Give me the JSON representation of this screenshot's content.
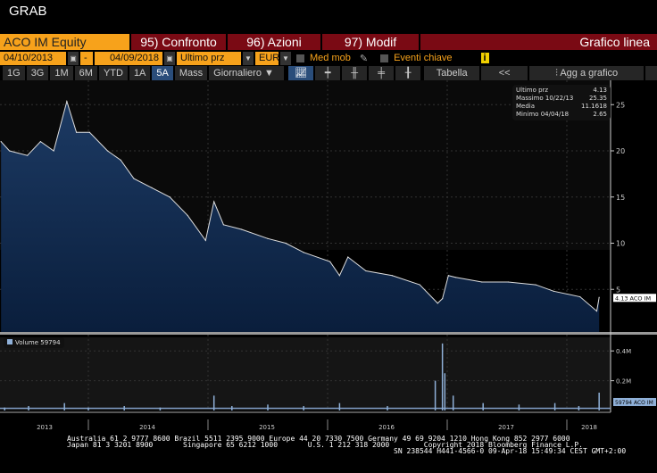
{
  "title": "GRAB",
  "toolbar": {
    "security": "ACO IM Equity",
    "compare": "95) Confronto",
    "actions": "96) Azioni",
    "modify": "97) Modif",
    "chart_type": "Grafico linea"
  },
  "controls": {
    "start_date": "04/10/2013",
    "dash": "-",
    "end_date": "04/09/2018",
    "field": "Ultimo prz",
    "currency": "EUR",
    "moving_avg": "Med mob",
    "key_events": "Eventi chiave",
    "info": "i"
  },
  "periods": [
    "1G",
    "3G",
    "1M",
    "6M",
    "YTD",
    "1A",
    "5A",
    "Mass"
  ],
  "selected_period": "5A",
  "frequency": "Giornaliero ▼",
  "table_label": "Tabella",
  "collapse_label": "<<",
  "add_label": "Agg a grafico",
  "legend": {
    "rows": [
      [
        "Ultimo prz",
        "4.13"
      ],
      [
        "Massimo 10/22/13",
        "25.35"
      ],
      [
        "Media",
        "11.1618"
      ],
      [
        "Minimo 04/04/18",
        "2.65"
      ]
    ]
  },
  "volume_legend": "Volume 59794",
  "price_tag": "4.13 ACO IM",
  "volume_tag": "59794 ACO IM",
  "footer": "Australia 61 2 9777 8600 Brazil 5511 2395 9000 Europe 44 20 7330 7500 Germany 49 69 9204 1210 Hong Kong 852 2977 6000\nJapan 81 3 3201 8900       Singapore 65 6212 1000       U.S. 1 212 318 2000        Copyright 2018 Bloomberg Finance L.P.\n                                                                            SN 238544 H441-4566-0 09-Apr-18 15:49:34 CEST GMT+2:00",
  "chart_data": {
    "type": "area",
    "x_ticks": [
      "2013",
      "2014",
      "2015",
      "2016",
      "2017",
      "2018"
    ],
    "price_ticks": [
      5,
      10,
      15,
      20,
      25
    ],
    "volume_ticks": [
      "0.2M",
      "0.4M"
    ],
    "xlim": [
      2013.27,
      2018.35
    ],
    "ylim": [
      0,
      26.5
    ],
    "price": [
      [
        2013.27,
        21
      ],
      [
        2013.34,
        20
      ],
      [
        2013.49,
        19.5
      ],
      [
        2013.6,
        21
      ],
      [
        2013.71,
        20
      ],
      [
        2013.82,
        25.35
      ],
      [
        2013.9,
        22
      ],
      [
        2014.01,
        22
      ],
      [
        2014.16,
        20
      ],
      [
        2014.27,
        19
      ],
      [
        2014.38,
        17
      ],
      [
        2014.53,
        16
      ],
      [
        2014.68,
        15
      ],
      [
        2014.83,
        13
      ],
      [
        2014.98,
        10.3
      ],
      [
        2015.05,
        14.5
      ],
      [
        2015.13,
        12
      ],
      [
        2015.28,
        11.5
      ],
      [
        2015.5,
        10.5
      ],
      [
        2015.65,
        10
      ],
      [
        2015.8,
        9
      ],
      [
        2016.02,
        8
      ],
      [
        2016.1,
        6.5
      ],
      [
        2016.17,
        8.5
      ],
      [
        2016.32,
        7
      ],
      [
        2016.54,
        6.5
      ],
      [
        2016.77,
        5.5
      ],
      [
        2016.92,
        3.5
      ],
      [
        2016.96,
        4
      ],
      [
        2017.01,
        6.5
      ],
      [
        2017.07,
        6.3
      ],
      [
        2017.29,
        5.8
      ],
      [
        2017.51,
        5.8
      ],
      [
        2017.74,
        5.5
      ],
      [
        2017.89,
        4.8
      ],
      [
        2018.11,
        4.2
      ],
      [
        2018.25,
        2.65
      ],
      [
        2018.27,
        4.13
      ]
    ],
    "volume_m": [
      [
        2013.3,
        0.02
      ],
      [
        2013.5,
        0.03
      ],
      [
        2013.8,
        0.05
      ],
      [
        2014.0,
        0.02
      ],
      [
        2014.3,
        0.03
      ],
      [
        2014.6,
        0.02
      ],
      [
        2015.05,
        0.1
      ],
      [
        2015.2,
        0.03
      ],
      [
        2015.5,
        0.04
      ],
      [
        2015.8,
        0.03
      ],
      [
        2016.1,
        0.05
      ],
      [
        2016.5,
        0.03
      ],
      [
        2016.9,
        0.2
      ],
      [
        2016.96,
        0.45
      ],
      [
        2016.98,
        0.25
      ],
      [
        2017.05,
        0.1
      ],
      [
        2017.3,
        0.05
      ],
      [
        2017.6,
        0.04
      ],
      [
        2017.9,
        0.05
      ],
      [
        2018.1,
        0.03
      ],
      [
        2018.27,
        0.12
      ]
    ]
  }
}
